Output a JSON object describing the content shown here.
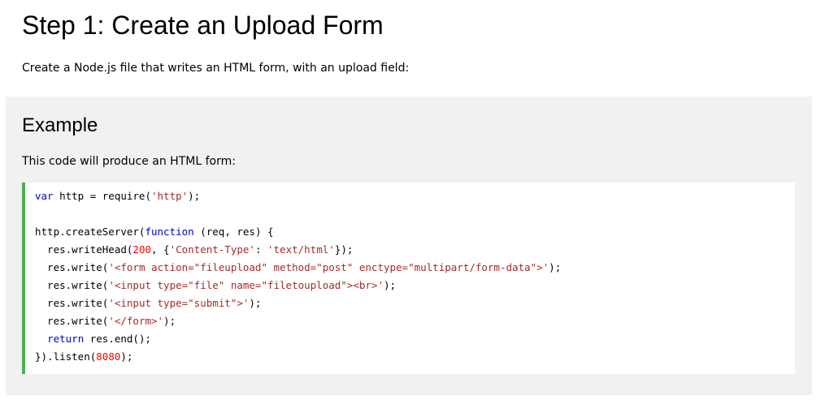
{
  "heading": "Step 1: Create an Upload Form",
  "intro": "Create a Node.js file that writes an HTML form, with an upload field:",
  "example": {
    "title": "Example",
    "description": "This code will produce an HTML form:",
    "code_lines": [
      [
        {
          "t": "var",
          "c": "kw"
        },
        {
          "t": " http = require(",
          "c": ""
        },
        {
          "t": "'http'",
          "c": "str"
        },
        {
          "t": ");",
          "c": ""
        }
      ],
      [],
      [
        {
          "t": "http.createServer(",
          "c": ""
        },
        {
          "t": "function",
          "c": "kw"
        },
        {
          "t": " (req, res) {",
          "c": ""
        }
      ],
      [
        {
          "t": "  res.writeHead(",
          "c": ""
        },
        {
          "t": "200",
          "c": "num"
        },
        {
          "t": ", {",
          "c": ""
        },
        {
          "t": "'Content-Type'",
          "c": "str"
        },
        {
          "t": ": ",
          "c": ""
        },
        {
          "t": "'text/html'",
          "c": "str"
        },
        {
          "t": "});",
          "c": ""
        }
      ],
      [
        {
          "t": "  res.write(",
          "c": ""
        },
        {
          "t": "'<form action=\"fileupload\" method=\"post\" enctype=\"multipart/form-data\">'",
          "c": "str"
        },
        {
          "t": ");",
          "c": ""
        }
      ],
      [
        {
          "t": "  res.write(",
          "c": ""
        },
        {
          "t": "'<input type=\"file\" name=\"filetoupload\"><br>'",
          "c": "str"
        },
        {
          "t": ");",
          "c": ""
        }
      ],
      [
        {
          "t": "  res.write(",
          "c": ""
        },
        {
          "t": "'<input type=\"submit\">'",
          "c": "str"
        },
        {
          "t": ");",
          "c": ""
        }
      ],
      [
        {
          "t": "  res.write(",
          "c": ""
        },
        {
          "t": "'</form>'",
          "c": "str"
        },
        {
          "t": ");",
          "c": ""
        }
      ],
      [
        {
          "t": "  ",
          "c": ""
        },
        {
          "t": "return",
          "c": "kw"
        },
        {
          "t": " res.end();",
          "c": ""
        }
      ],
      [
        {
          "t": "}).listen(",
          "c": ""
        },
        {
          "t": "8080",
          "c": "num"
        },
        {
          "t": ");",
          "c": ""
        }
      ]
    ]
  },
  "colors": {
    "accent_border": "#4caf50",
    "example_background": "#f1f1f1",
    "keyword": "#0000cd",
    "string": "#a52a2a",
    "number": "#ff0000"
  }
}
